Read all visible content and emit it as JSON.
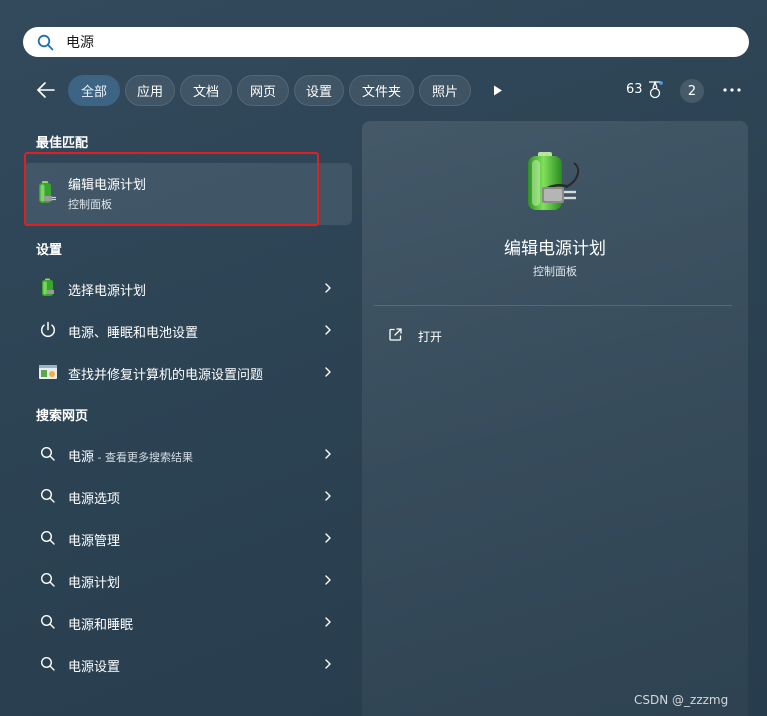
{
  "search": {
    "value": "电源",
    "placeholder": ""
  },
  "filters": {
    "chips": [
      {
        "label": "全部"
      },
      {
        "label": "应用"
      },
      {
        "label": "文档"
      },
      {
        "label": "网页"
      },
      {
        "label": "设置"
      },
      {
        "label": "文件夹"
      },
      {
        "label": "照片"
      }
    ],
    "points": "63",
    "badge_count": "2"
  },
  "best_match": {
    "header": "最佳匹配",
    "title": "编辑电源计划",
    "subtitle": "控制面板"
  },
  "settings": {
    "header": "设置",
    "items": [
      {
        "label": "选择电源计划"
      },
      {
        "label": "电源、睡眠和电池设置"
      },
      {
        "label": "查找并修复计算机的电源设置问题"
      }
    ]
  },
  "web": {
    "header": "搜索网页",
    "items": [
      {
        "label": "电源",
        "suffix": " - 查看更多搜索结果"
      },
      {
        "label": "电源选项"
      },
      {
        "label": "电源管理"
      },
      {
        "label": "电源计划"
      },
      {
        "label": "电源和睡眠"
      },
      {
        "label": "电源设置"
      }
    ]
  },
  "detail": {
    "title": "编辑电源计划",
    "subtitle": "控制面板",
    "open_label": "打开"
  },
  "watermark": "CSDN @_zzzmg",
  "colors": {
    "highlight_border": "#e02020",
    "active_chip": "#3d6482",
    "search_accent": "#1f6fb5"
  }
}
